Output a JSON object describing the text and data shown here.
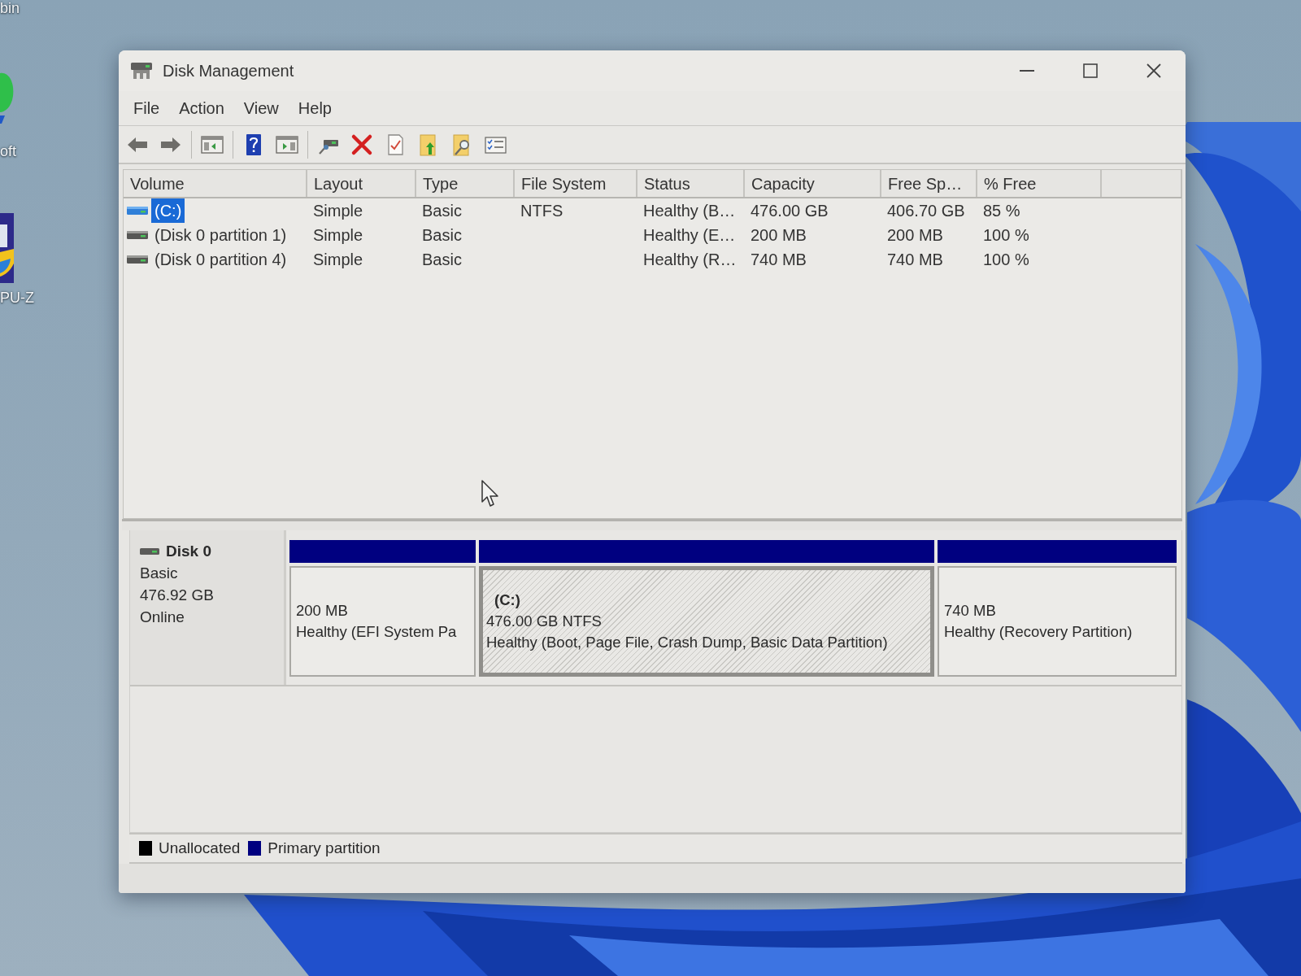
{
  "desktop": {
    "icons": [
      {
        "kind": "hidden",
        "label": "bin"
      },
      {
        "kind": "leaf",
        "label": "oft"
      },
      {
        "kind": "tile",
        "label": "PU-Z"
      }
    ]
  },
  "window": {
    "title": "Disk Management"
  },
  "menu": [
    "File",
    "Action",
    "View",
    "Help"
  ],
  "volume_list": {
    "columns": [
      "Volume",
      "Layout",
      "Type",
      "File System",
      "Status",
      "Capacity",
      "Free Sp…",
      "% Free"
    ],
    "rows": [
      {
        "selected": true,
        "cells": [
          "(C:)",
          "Simple",
          "Basic",
          "NTFS",
          "Healthy (B…",
          "476.00 GB",
          "406.70 GB",
          "85 %"
        ]
      },
      {
        "selected": false,
        "cells": [
          "(Disk 0 partition 1)",
          "Simple",
          "Basic",
          null,
          "Healthy (E…",
          "200 MB",
          "200 MB",
          "100 %"
        ]
      },
      {
        "selected": false,
        "cells": [
          "(Disk 0 partition 4)",
          "Simple",
          "Basic",
          null,
          "Healthy (R…",
          "740 MB",
          "740 MB",
          "100 %"
        ]
      }
    ]
  },
  "disk": {
    "name": "Disk 0",
    "type": "Basic",
    "size": "476.92 GB",
    "status": "Online",
    "partitions": [
      {
        "kind": "primary",
        "selected": false,
        "size": "200 MB",
        "status": "Healthy (EFI System Pa"
      },
      {
        "kind": "primary",
        "selected": true,
        "label": "(C:)",
        "size": "476.00 GB NTFS",
        "status": "Healthy (Boot, Page File, Crash Dump, Basic Data Partition)"
      },
      {
        "kind": "primary",
        "selected": false,
        "size": "740 MB",
        "status": "Healthy (Recovery Partition)"
      }
    ]
  },
  "legend": [
    {
      "label": "Unallocated",
      "color": "#000000"
    },
    {
      "label": "Primary partition",
      "color": "#000080"
    }
  ]
}
